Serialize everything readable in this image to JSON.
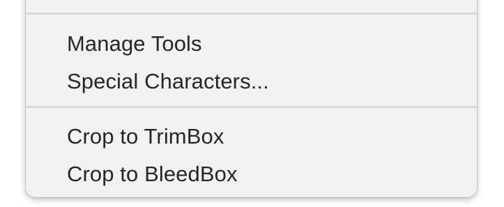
{
  "menu": {
    "groups": [
      {
        "items": [
          {
            "label": "Manage Tools"
          },
          {
            "label": "Special Characters..."
          }
        ]
      },
      {
        "items": [
          {
            "label": "Crop to TrimBox"
          },
          {
            "label": "Crop to BleedBox"
          }
        ]
      }
    ]
  },
  "colors": {
    "menu_background": "#f1f1f1",
    "separator": "#d9d9d9",
    "text": "#262626",
    "page_background": "#ffffff"
  }
}
